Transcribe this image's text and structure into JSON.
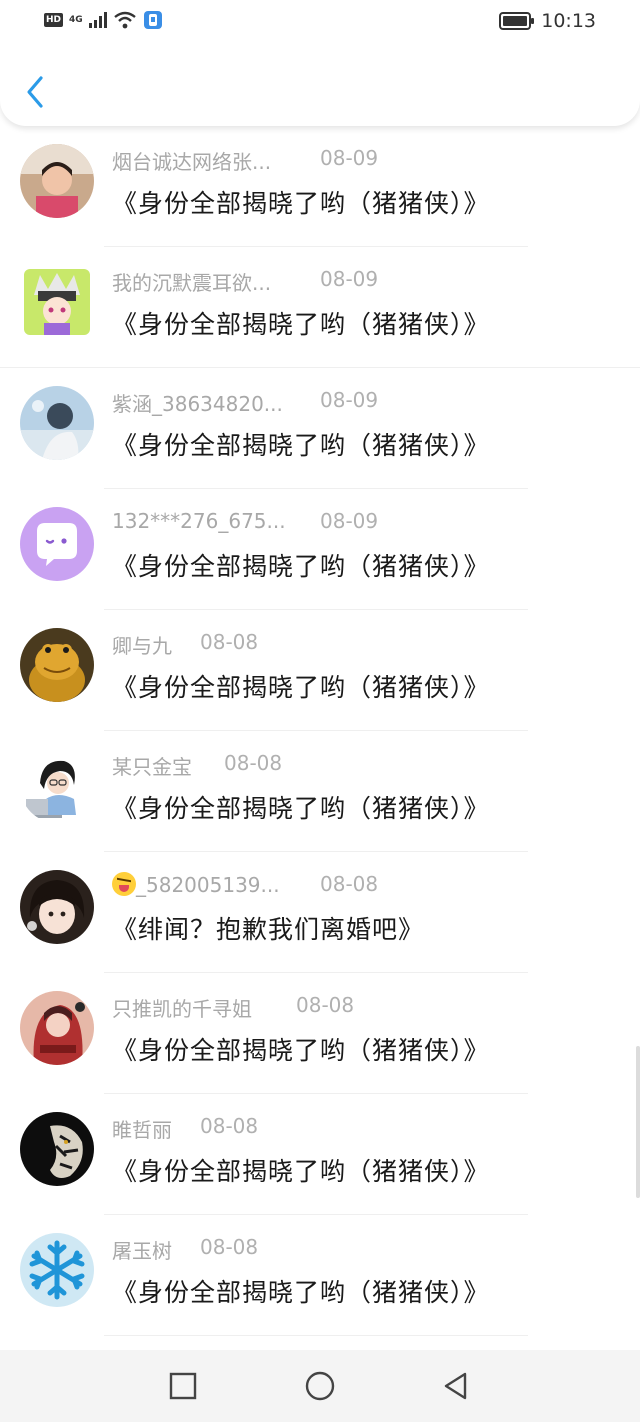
{
  "status_bar": {
    "network_badge": "HD",
    "network_type": "4G",
    "battery_icon": "battery-icon",
    "time": "10:13"
  },
  "header": {
    "back_icon": "chevron-left-icon",
    "accent_color": "#2b9be8"
  },
  "messages": [
    {
      "name": "烟台诚达网络张...",
      "date": "08-09",
      "title": "《身份全部揭晓了哟（猪猪侠）》"
    },
    {
      "name": "我的沉默震耳欲...",
      "date": "08-09",
      "title": "《身份全部揭晓了哟（猪猪侠）》"
    },
    {
      "name": "紫涵_38634820...",
      "date": "08-09",
      "title": "《身份全部揭晓了哟（猪猪侠）》"
    },
    {
      "name": "132***276_675...",
      "date": "08-09",
      "title": "《身份全部揭晓了哟（猪猪侠）》"
    },
    {
      "name": "卿与九",
      "date": "08-08",
      "title": "《身份全部揭晓了哟（猪猪侠）》"
    },
    {
      "name": "某只金宝",
      "date": "08-08",
      "title": "《身份全部揭晓了哟（猪猪侠）》"
    },
    {
      "name": "_582005139...",
      "date": "08-08",
      "title": "《绯闻？抱歉我们离婚吧》",
      "emoji": "squinting-tongue-emoji"
    },
    {
      "name": "只推凯的千寻姐",
      "date": "08-08",
      "title": "《身份全部揭晓了哟（猪猪侠）》"
    },
    {
      "name": "睢哲丽",
      "date": "08-08",
      "title": "《身份全部揭晓了哟（猪猪侠）》"
    },
    {
      "name": "屠玉树",
      "date": "08-08",
      "title": "《身份全部揭晓了哟（猪猪侠）》"
    }
  ],
  "nav_bar": {
    "recents_icon": "square-icon",
    "home_icon": "circle-icon",
    "back_icon": "triangle-back-icon"
  }
}
